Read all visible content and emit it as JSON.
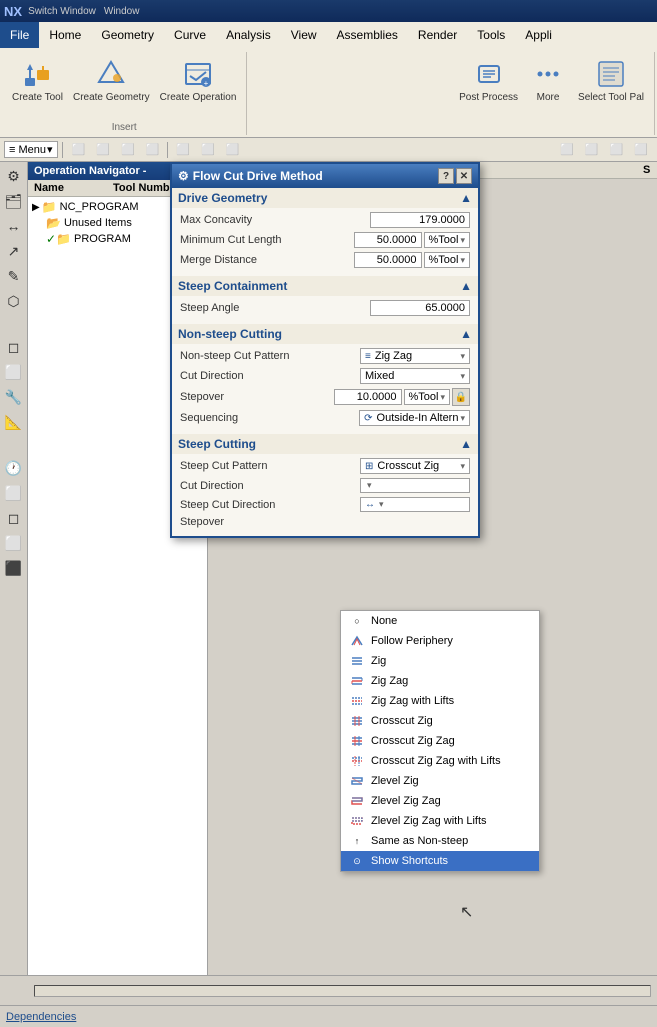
{
  "topbar": {
    "app": "NX",
    "switch_window": "Switch Window",
    "window": "Window"
  },
  "menubar": {
    "items": [
      "File",
      "Home",
      "Geometry",
      "Curve",
      "Analysis",
      "View",
      "Assemblies",
      "Render",
      "Tools",
      "Appli"
    ]
  },
  "ribbon": {
    "create_tool_label": "Create Tool",
    "create_geometry_label": "Create Geometry",
    "create_operation_label": "Create Operation",
    "insert_label": "Insert",
    "post_process_label": "Post Process",
    "more_label": "More",
    "select_tool_label": "Select Tool Pal"
  },
  "toolbar": {
    "menu_label": "≡ Menu",
    "dropdown_placeholder": ""
  },
  "nav": {
    "header": "Operation Navigator -",
    "col_name": "Name",
    "col_tool_number": "Tool Number",
    "col_s": "S",
    "program": "NC_PROGRAM",
    "unused": "Unused Items",
    "program2": "PROGRAM"
  },
  "dialog": {
    "title": "Flow Cut Drive Method",
    "sections": {
      "drive_geometry": "Drive Geometry",
      "steep_containment": "Steep Containment",
      "non_steep_cutting": "Non-steep Cutting",
      "steep_cutting": "Steep Cutting"
    },
    "drive_geometry": {
      "max_concavity_label": "Max Concavity",
      "max_concavity_value": "179.0000",
      "min_cut_length_label": "Minimum Cut Length",
      "min_cut_length_value": "50.0000",
      "min_cut_length_unit": "%Tool",
      "merge_distance_label": "Merge Distance",
      "merge_distance_value": "50.0000",
      "merge_distance_unit": "%Tool"
    },
    "steep_containment": {
      "steep_angle_label": "Steep Angle",
      "steep_angle_value": "65.0000"
    },
    "non_steep": {
      "cut_pattern_label": "Non-steep Cut Pattern",
      "cut_pattern_value": "Zig Zag",
      "cut_direction_label": "Cut Direction",
      "cut_direction_value": "Mixed",
      "stepover_label": "Stepover",
      "stepover_value": "10.0000",
      "stepover_unit": "%Tool",
      "sequencing_label": "Sequencing",
      "sequencing_value": "Outside-In Altern"
    },
    "steep": {
      "cut_pattern_label": "Steep Cut Pattern",
      "cut_pattern_value": "Crosscut Zig",
      "cut_direction_label": "Cut Direction",
      "cut_direction_value": "",
      "steep_cut_direction_label": "Steep Cut Direction",
      "stepover_label": "Stepover"
    }
  },
  "dropdown": {
    "items": [
      {
        "label": "None",
        "icon": "circle"
      },
      {
        "label": "Follow Periphery",
        "icon": "follow"
      },
      {
        "label": "Zig",
        "icon": "zig"
      },
      {
        "label": "Zig Zag",
        "icon": "zigzag"
      },
      {
        "label": "Zig Zag with Lifts",
        "icon": "zigzag-lifts"
      },
      {
        "label": "Crosscut Zig",
        "icon": "crosscut-zig"
      },
      {
        "label": "Crosscut Zig Zag",
        "icon": "crosscut-zigzag"
      },
      {
        "label": "Crosscut Zig Zag with Lifts",
        "icon": "crosscut-zigzag-lifts"
      },
      {
        "label": "Zlevel Zig",
        "icon": "zlevel-zig"
      },
      {
        "label": "Zlevel Zig Zag",
        "icon": "zlevel-zigzag"
      },
      {
        "label": "Zlevel Zig Zag with Lifts",
        "icon": "zlevel-lifts"
      },
      {
        "label": "Same as Non-steep",
        "icon": "same"
      },
      {
        "label": "Show Shortcuts",
        "icon": "shortcuts"
      }
    ]
  },
  "statusbar": {
    "dependencies": "Dependencies"
  }
}
